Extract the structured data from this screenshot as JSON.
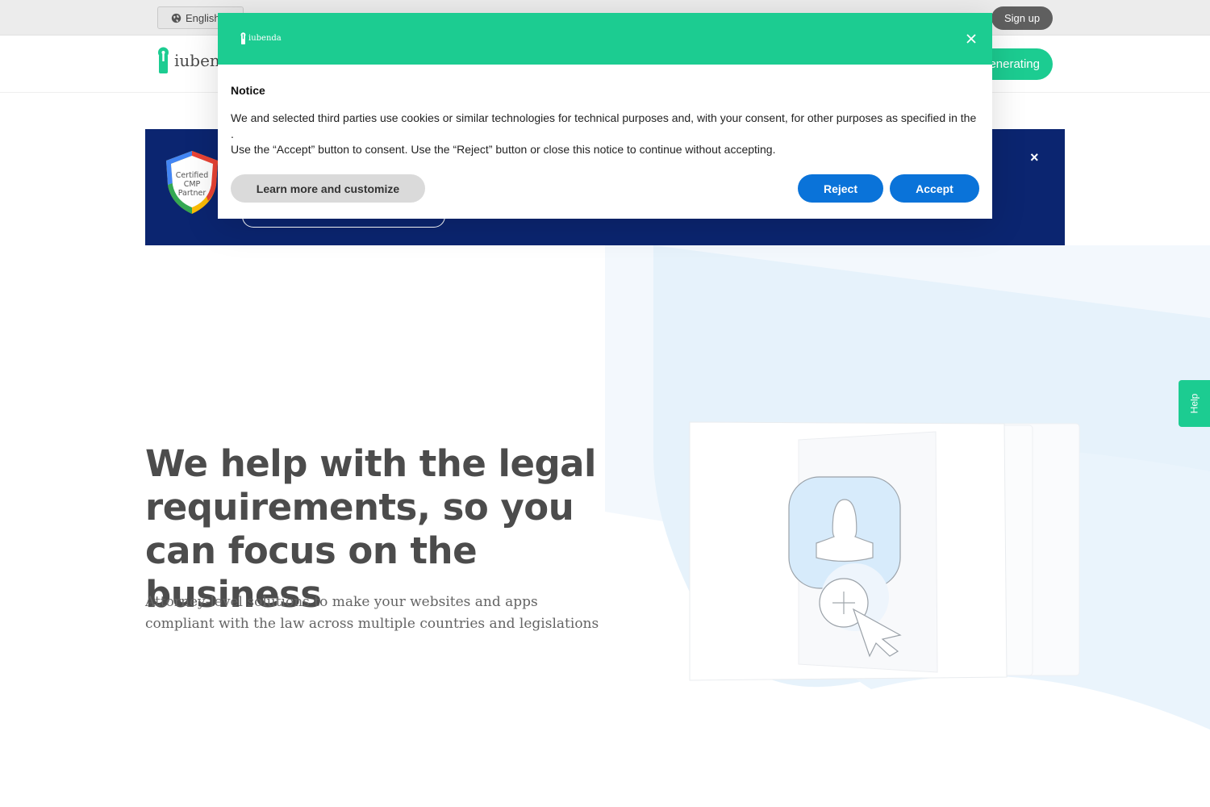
{
  "topbar": {
    "language_label": "English",
    "signup_label": "Sign up",
    "menu_dots": "· ·"
  },
  "header": {
    "logo_text": "iubenda",
    "cta_label": "enerating"
  },
  "banner": {
    "badge_text": [
      "Certified",
      "CMP",
      "Partner"
    ],
    "close_label": "×"
  },
  "hero": {
    "title": "We help with the legal requirements, so you can focus on the business",
    "subtitle": "Attorney-level solutions to make your websites and apps compliant with the law across multiple countries and legislations"
  },
  "help_tab": {
    "label": "Help"
  },
  "cookie_notice": {
    "logo_text": "iubenda",
    "title": "Notice",
    "paragraph_1": "We and selected third parties use cookies or similar technologies for technical purposes and, with your consent, for other purposes as specified in the .",
    "paragraph_2": "Use the “Accept” button to consent. Use the “Reject” button or close this notice to continue without accepting.",
    "learn_more_label": "Learn more and customize",
    "reject_label": "Reject",
    "accept_label": "Accept"
  },
  "colors": {
    "brand_green": "#1ccc91",
    "banner_navy": "#0b2570",
    "button_blue": "#0a73d9"
  }
}
